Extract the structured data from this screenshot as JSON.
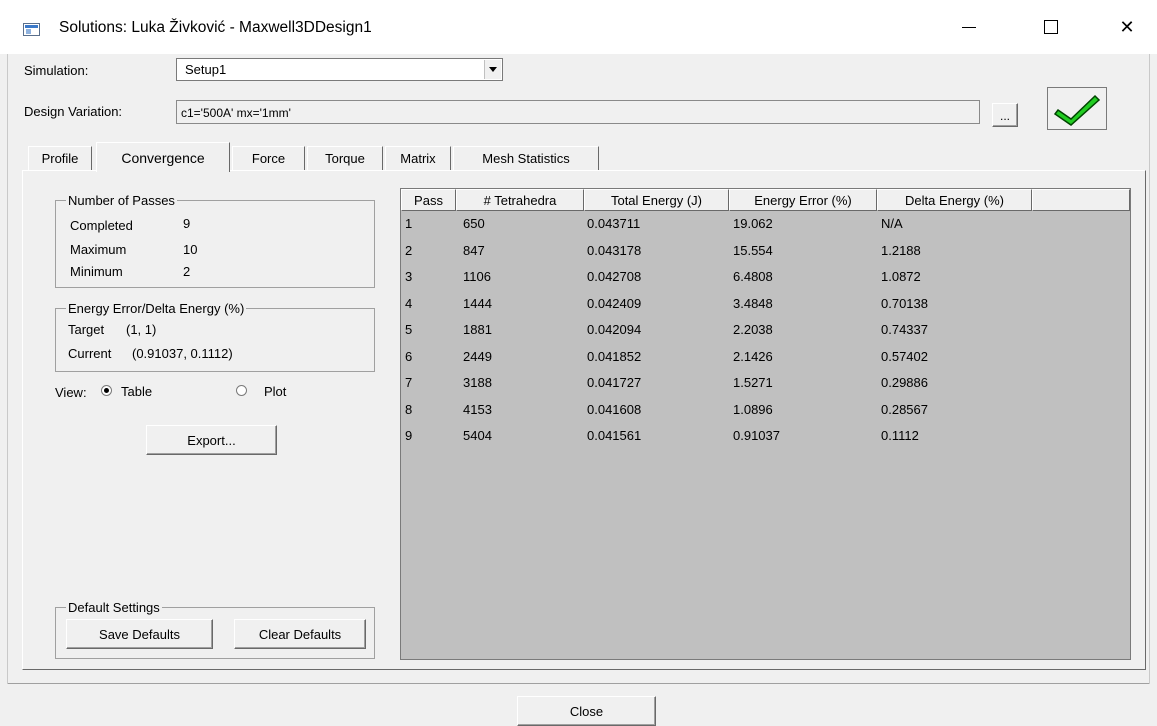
{
  "window": {
    "title": "Solutions: Luka Živković - Maxwell3DDesign1",
    "controls": {
      "minimize": "—",
      "close": "✕"
    }
  },
  "simulation": {
    "label": "Simulation:",
    "value": "Setup1"
  },
  "design_variation": {
    "label": "Design Variation:",
    "value": "c1='500A' mx='1mm'",
    "browse_label": "..."
  },
  "status": {
    "icon": "green-checkmark-icon",
    "color": "#22cc22"
  },
  "tabs": [
    {
      "label": "Profile",
      "active": false
    },
    {
      "label": "Convergence",
      "active": true
    },
    {
      "label": "Force",
      "active": false
    },
    {
      "label": "Torque",
      "active": false
    },
    {
      "label": "Matrix",
      "active": false
    },
    {
      "label": "Mesh Statistics",
      "active": false
    }
  ],
  "passes": {
    "title": "Number of Passes",
    "completed_label": "Completed",
    "completed_value": "9",
    "maximum_label": "Maximum",
    "maximum_value": "10",
    "minimum_label": "Minimum",
    "minimum_value": "2"
  },
  "energy": {
    "title": "Energy Error/Delta Energy (%)",
    "target_label": "Target",
    "target_value": "(1, 1)",
    "current_label": "Current",
    "current_value": "(0.91037, 0.1112)"
  },
  "view": {
    "label": "View:",
    "table_label": "Table",
    "plot_label": "Plot",
    "selected": "Table"
  },
  "export_label": "Export...",
  "defaults": {
    "title": "Default Settings",
    "save_label": "Save Defaults",
    "clear_label": "Clear Defaults"
  },
  "table": {
    "headers": [
      "Pass",
      "# Tetrahedra",
      "Total Energy (J)",
      "Energy Error (%)",
      "Delta Energy (%)"
    ],
    "rows": [
      [
        "1",
        "650",
        "0.043711",
        "19.062",
        "N/A"
      ],
      [
        "2",
        "847",
        "0.043178",
        "15.554",
        "1.2188"
      ],
      [
        "3",
        "1106",
        "0.042708",
        "6.4808",
        "1.0872"
      ],
      [
        "4",
        "1444",
        "0.042409",
        "3.4848",
        "0.70138"
      ],
      [
        "5",
        "1881",
        "0.042094",
        "2.2038",
        "0.74337"
      ],
      [
        "6",
        "2449",
        "0.041852",
        "2.1426",
        "0.57402"
      ],
      [
        "7",
        "3188",
        "0.041727",
        "1.5271",
        "0.29886"
      ],
      [
        "8",
        "4153",
        "0.041608",
        "1.0896",
        "0.28567"
      ],
      [
        "9",
        "5404",
        "0.041561",
        "0.91037",
        "0.1112"
      ]
    ]
  },
  "close_label": "Close"
}
